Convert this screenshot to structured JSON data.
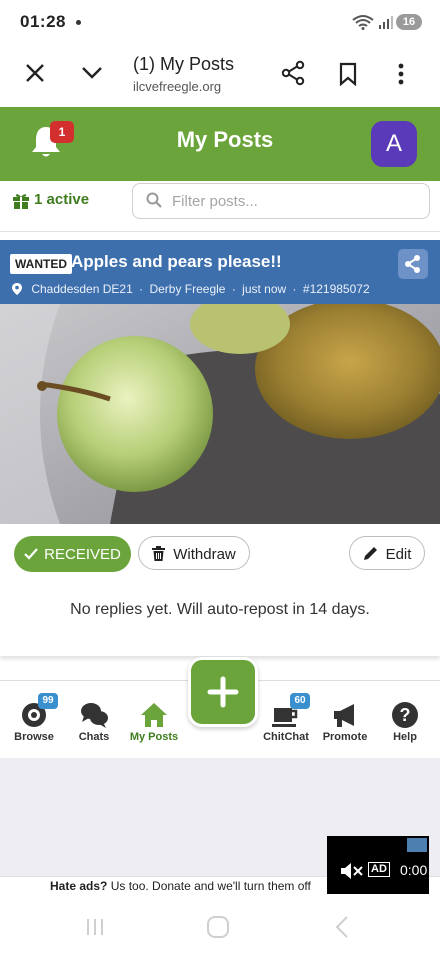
{
  "status_bar": {
    "time": "01:28",
    "battery": "16"
  },
  "browser": {
    "title": "(1) My Posts",
    "url": "ilcvefreegle.org"
  },
  "header": {
    "title": "My Posts",
    "notification_count": "1",
    "avatar_letter": "A"
  },
  "filter": {
    "active_label": "1 active",
    "placeholder": "Filter posts..."
  },
  "post": {
    "badge": "WANTED",
    "title": "Apples and pears please!!",
    "location": "Chaddesden DE21",
    "group": "Derby Freegle",
    "time": "just now",
    "id": "#121985072",
    "received_label": "RECEIVED",
    "withdraw_label": "Withdraw",
    "edit_label": "Edit",
    "status_text": "No replies yet. Will auto-repost in 14 days."
  },
  "nav": {
    "items": [
      {
        "label": "Browse",
        "icon": "eye-icon",
        "badge": "99"
      },
      {
        "label": "Chats",
        "icon": "chat-bubbles-icon"
      },
      {
        "label": "My Posts",
        "icon": "home-icon"
      },
      {
        "label": "ChitChat",
        "icon": "coffee-cup-icon",
        "badge": "60"
      },
      {
        "label": "Promote",
        "icon": "megaphone-icon"
      },
      {
        "label": "Help",
        "icon": "question-icon"
      }
    ],
    "fab_icon": "plus-icon"
  },
  "ad": {
    "text_bold": "Hate ads?",
    "text": " Us too. Donate and we'll turn them off",
    "video_label": "AD",
    "video_time": "0:00"
  },
  "colors": {
    "brand_green": "#6aa43a",
    "post_blue": "#3e6fad",
    "badge_red": "#d32f2f",
    "avatar_purple": "#5a3ab8"
  }
}
